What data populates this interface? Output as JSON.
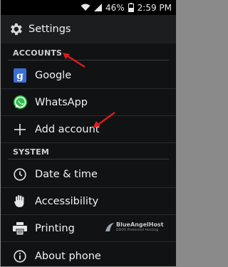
{
  "status_bar": {
    "battery": "46%",
    "time": "2:59 PM"
  },
  "action_bar": {
    "title": "Settings",
    "icon": "gear-icon"
  },
  "sections": {
    "accounts": "ACCOUNTS",
    "system": "SYSTEM"
  },
  "accounts_items": [
    {
      "label": "Google",
      "icon": "google-icon"
    },
    {
      "label": "WhatsApp",
      "icon": "whatsapp-icon"
    },
    {
      "label": "Add account",
      "icon": "plus-icon"
    }
  ],
  "system_items": [
    {
      "label": "Date & time",
      "icon": "clock-icon"
    },
    {
      "label": "Accessibility",
      "icon": "hand-icon"
    },
    {
      "label": "Printing",
      "icon": "printer-icon"
    },
    {
      "label": "About phone",
      "icon": "info-icon"
    }
  ],
  "watermark": {
    "title": "BlueAngelHost",
    "subtitle": "DDOS Protected Hosting"
  },
  "colors": {
    "annotation_arrow": "#e01b1b",
    "google_blue": "#3b6fd6",
    "whatsapp_green": "#2fbe4b"
  }
}
